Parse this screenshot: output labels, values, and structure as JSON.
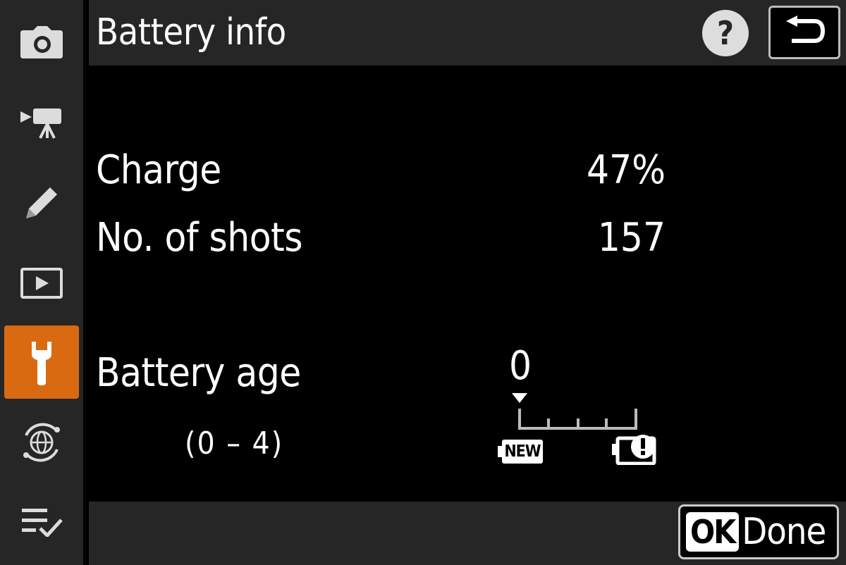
{
  "header": {
    "title": "Battery info",
    "help_symbol": "?"
  },
  "sidebar": {
    "items": [
      {
        "icon": "camera-icon",
        "active": false
      },
      {
        "icon": "movie-camera-icon",
        "active": false
      },
      {
        "icon": "pencil-icon",
        "active": false
      },
      {
        "icon": "playback-icon",
        "active": false
      },
      {
        "icon": "wrench-icon",
        "active": true
      },
      {
        "icon": "network-globe-icon",
        "active": false
      },
      {
        "icon": "my-menu-checklist-icon",
        "active": false
      }
    ],
    "active_color": "#d96a12"
  },
  "main": {
    "charge_label": "Charge",
    "charge_value": "47%",
    "shots_label": "No. of shots",
    "shots_value": "157",
    "age_label": "Battery age",
    "age_range": "(0 – 4)",
    "age_value": "0",
    "age_new_label": "NEW"
  },
  "footer": {
    "ok_label": "OK",
    "done_label": "Done"
  }
}
